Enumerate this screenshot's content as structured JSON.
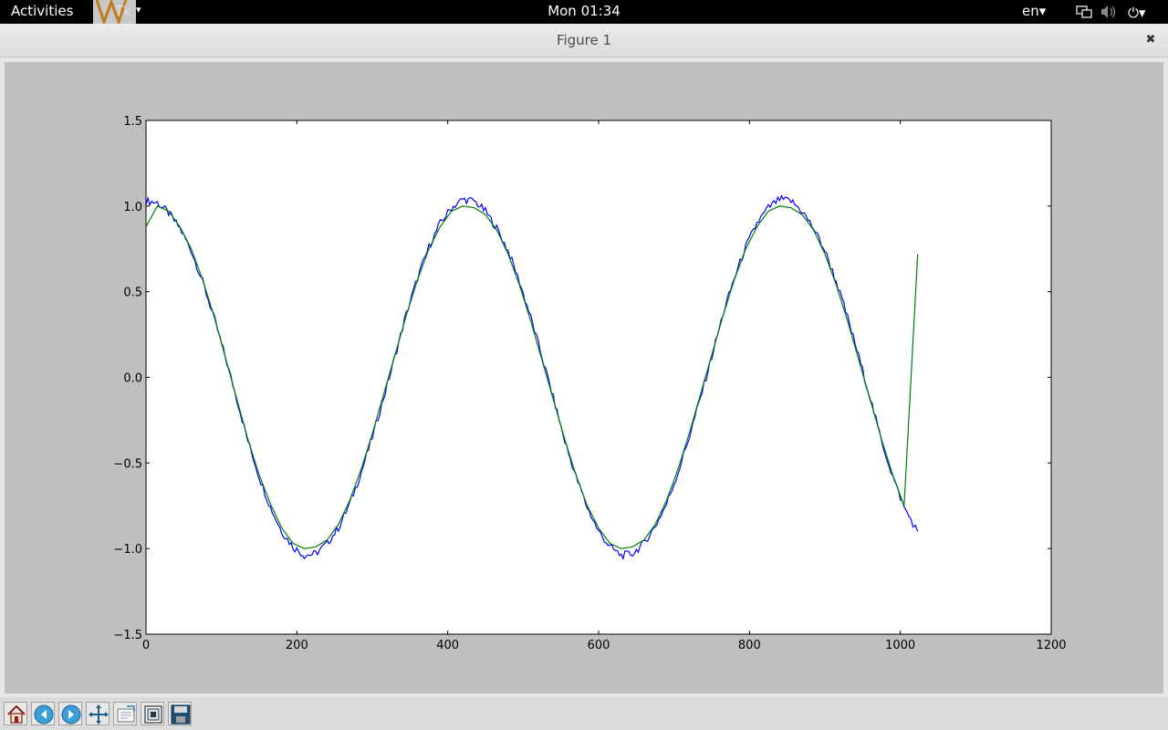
{
  "topbar": {
    "activities": "Activities",
    "app_label": "Tk",
    "app_arrow": "▾",
    "clock": "Mon 01:34",
    "language": "en▾",
    "network_icon": "network-icon",
    "volume_icon": "volume-icon",
    "power": "⏻▾"
  },
  "window": {
    "title": "Figure 1",
    "close": "✖"
  },
  "toolbar": {
    "items": [
      {
        "icon": "home-icon"
      },
      {
        "icon": "back-arrow-icon"
      },
      {
        "icon": "forward-arrow-icon"
      },
      {
        "icon": "pan-move-icon"
      },
      {
        "icon": "zoom-rect-icon"
      },
      {
        "icon": "subplots-config-icon"
      },
      {
        "icon": "save-disk-icon"
      }
    ]
  },
  "chart_data": {
    "type": "line",
    "title": "",
    "xlabel": "",
    "ylabel": "",
    "xlim": [
      0,
      1200
    ],
    "ylim": [
      -1.5,
      1.5
    ],
    "xticks": [
      0,
      200,
      400,
      600,
      800,
      1000,
      1200
    ],
    "xtick_labels": [
      "0",
      "200",
      "400",
      "600",
      "800",
      "1000",
      "1200"
    ],
    "yticks": [
      -1.5,
      -1.0,
      -0.5,
      0.0,
      0.5,
      1.0,
      1.5
    ],
    "ytick_labels": [
      "−1.5",
      "−1.0",
      "−0.5",
      "0.0",
      "0.5",
      "1.0",
      "1.5"
    ],
    "grid": false,
    "series": [
      {
        "color": "#0000ff",
        "style": "noisy",
        "x": [
          0,
          15,
          30,
          45,
          60,
          75,
          90,
          105,
          120,
          135,
          150,
          165,
          180,
          195,
          210,
          225,
          240,
          255,
          270,
          285,
          300,
          315,
          330,
          345,
          360,
          375,
          390,
          405,
          420,
          435,
          450,
          465,
          480,
          495,
          510,
          525,
          540,
          555,
          570,
          585,
          600,
          615,
          630,
          645,
          660,
          675,
          690,
          705,
          720,
          735,
          750,
          765,
          780,
          795,
          810,
          825,
          840,
          855,
          870,
          885,
          900,
          915,
          930,
          945,
          960,
          975,
          990,
          1005,
          1023
        ],
        "y": [
          1.03,
          1.02,
          0.96,
          0.87,
          0.74,
          0.56,
          0.35,
          0.12,
          -0.12,
          -0.37,
          -0.58,
          -0.76,
          -0.9,
          -0.99,
          -1.04,
          -1.03,
          -0.97,
          -0.88,
          -0.74,
          -0.56,
          -0.35,
          -0.12,
          0.12,
          0.37,
          0.58,
          0.76,
          0.9,
          0.99,
          1.04,
          1.03,
          0.97,
          0.87,
          0.74,
          0.56,
          0.35,
          0.12,
          -0.12,
          -0.37,
          -0.58,
          -0.76,
          -0.9,
          -0.99,
          -1.04,
          -1.03,
          -0.97,
          -0.87,
          -0.74,
          -0.56,
          -0.35,
          -0.12,
          0.12,
          0.37,
          0.58,
          0.76,
          0.9,
          0.99,
          1.04,
          1.03,
          0.97,
          0.87,
          0.74,
          0.56,
          0.35,
          0.12,
          -0.12,
          -0.37,
          -0.58,
          -0.76,
          -0.9
        ]
      },
      {
        "color": "#008000",
        "style": "smooth",
        "x": [
          0,
          15,
          30,
          45,
          60,
          75,
          90,
          105,
          120,
          135,
          150,
          165,
          180,
          195,
          210,
          225,
          240,
          255,
          270,
          285,
          300,
          315,
          330,
          345,
          360,
          375,
          390,
          405,
          420,
          435,
          450,
          465,
          480,
          495,
          510,
          525,
          540,
          555,
          570,
          585,
          600,
          615,
          630,
          645,
          660,
          675,
          690,
          705,
          720,
          735,
          750,
          765,
          780,
          795,
          810,
          825,
          840,
          855,
          870,
          885,
          900,
          915,
          930,
          945,
          960,
          975,
          990,
          1005,
          1023
        ],
        "y": [
          0.88,
          1.0,
          0.97,
          0.88,
          0.75,
          0.57,
          0.36,
          0.12,
          -0.12,
          -0.36,
          -0.57,
          -0.74,
          -0.88,
          -0.97,
          -1.0,
          -0.99,
          -0.95,
          -0.86,
          -0.72,
          -0.54,
          -0.33,
          -0.1,
          0.13,
          0.36,
          0.57,
          0.75,
          0.88,
          0.97,
          1.0,
          0.99,
          0.95,
          0.86,
          0.72,
          0.54,
          0.33,
          0.1,
          -0.13,
          -0.36,
          -0.57,
          -0.75,
          -0.88,
          -0.97,
          -1.0,
          -0.99,
          -0.95,
          -0.86,
          -0.72,
          -0.54,
          -0.33,
          -0.1,
          0.13,
          0.36,
          0.57,
          0.75,
          0.88,
          0.97,
          1.0,
          0.99,
          0.95,
          0.86,
          0.72,
          0.54,
          0.33,
          0.1,
          -0.13,
          -0.36,
          -0.57,
          -0.75,
          0.72
        ]
      }
    ]
  }
}
